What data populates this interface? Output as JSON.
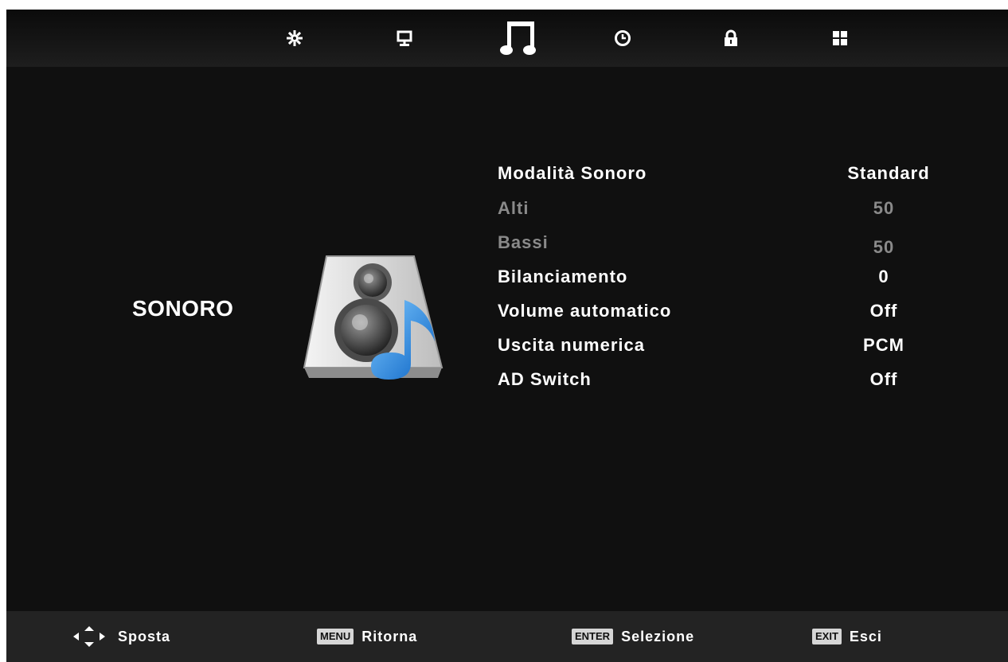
{
  "tabs": [
    {
      "icon": "picture-settings-icon",
      "label": "Immagine"
    },
    {
      "icon": "monitor-icon",
      "label": "Schermo"
    },
    {
      "icon": "music-note-icon",
      "label": "Sonoro",
      "active": true
    },
    {
      "icon": "clock-icon",
      "label": "Orario"
    },
    {
      "icon": "lock-icon",
      "label": "Blocco"
    },
    {
      "icon": "grid-icon",
      "label": "Opzioni"
    }
  ],
  "section": {
    "title": "SONORO",
    "icon": "speaker-music-icon"
  },
  "menu": {
    "items": [
      {
        "label": "Modalità Sonoro",
        "value": "Standard",
        "enabled": true
      },
      {
        "label": "Alti",
        "value": "50",
        "enabled": false
      },
      {
        "label": "Bassi",
        "value": "50",
        "enabled": false
      },
      {
        "label": "Bilanciamento",
        "value": "0",
        "enabled": true
      },
      {
        "label": "Volume automatico",
        "value": "Off",
        "enabled": true
      },
      {
        "label": "Uscita numerica",
        "value": "PCM",
        "enabled": true
      },
      {
        "label": "AD Switch",
        "value": "Off",
        "enabled": true
      }
    ]
  },
  "footer": {
    "hints": [
      {
        "key": "",
        "icon": "arrow-keys-icon",
        "label": "Sposta"
      },
      {
        "key": "MENU",
        "label": "Ritorna"
      },
      {
        "key": "ENTER",
        "label": "Selezione"
      },
      {
        "key": "EXIT",
        "label": "Esci"
      }
    ]
  },
  "colors": {
    "background": "#101010",
    "text": "#ffffff",
    "disabled_text": "#8a8a8a",
    "footer": "#232323",
    "keycap": "#d6d6d6"
  }
}
